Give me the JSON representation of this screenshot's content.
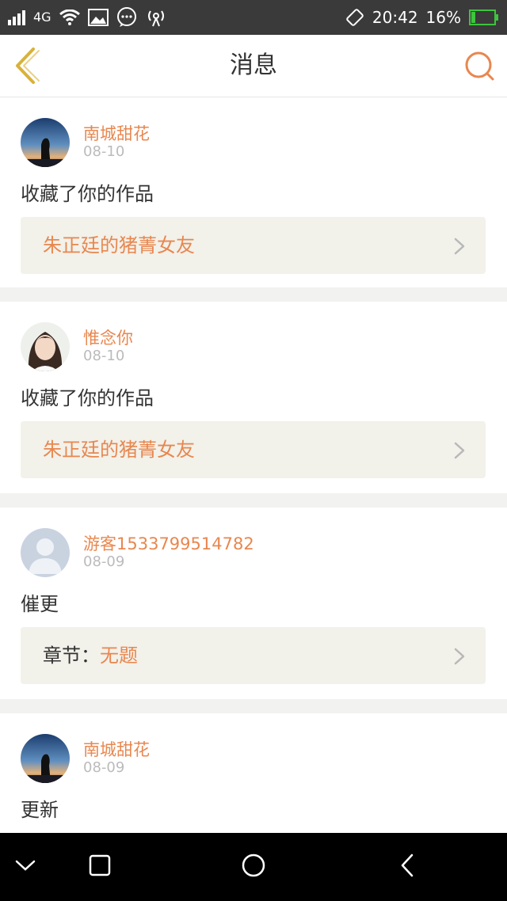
{
  "status_bar": {
    "network": "4G",
    "time": "20:42",
    "battery": "16%",
    "icons": [
      "signal-icon",
      "wifi-icon",
      "image-icon",
      "chat-icon",
      "hotspot-icon",
      "rotate-icon",
      "battery-icon"
    ]
  },
  "header": {
    "title": "消息",
    "back_icon": "chevron-left-icon",
    "search_icon": "search-icon"
  },
  "colors": {
    "accent": "#e8874f",
    "back_arrow": "#d9b23a",
    "card_ref_bg": "#f2f1ea"
  },
  "messages": [
    {
      "username": "南城甜花",
      "date": "08-10",
      "action": "收藏了你的作品",
      "ref_prefix": "",
      "ref_title": "朱正廷的猪菁女友",
      "avatar": "night-sky-avatar"
    },
    {
      "username": "惟念你",
      "date": "08-10",
      "action": "收藏了你的作品",
      "ref_prefix": "",
      "ref_title": "朱正廷的猪菁女友",
      "avatar": "girl-portrait-avatar"
    },
    {
      "username": "游客1533799514782",
      "date": "08-09",
      "action": "催更",
      "ref_prefix": "章节：",
      "ref_title": "无题",
      "avatar": "default-user-avatar"
    },
    {
      "username": "南城甜花",
      "date": "08-09",
      "action": "更新",
      "avatar": "night-sky-avatar"
    }
  ],
  "nav_bar": {
    "icons": [
      "collapse-icon",
      "recents-icon",
      "home-icon",
      "back-icon"
    ]
  }
}
